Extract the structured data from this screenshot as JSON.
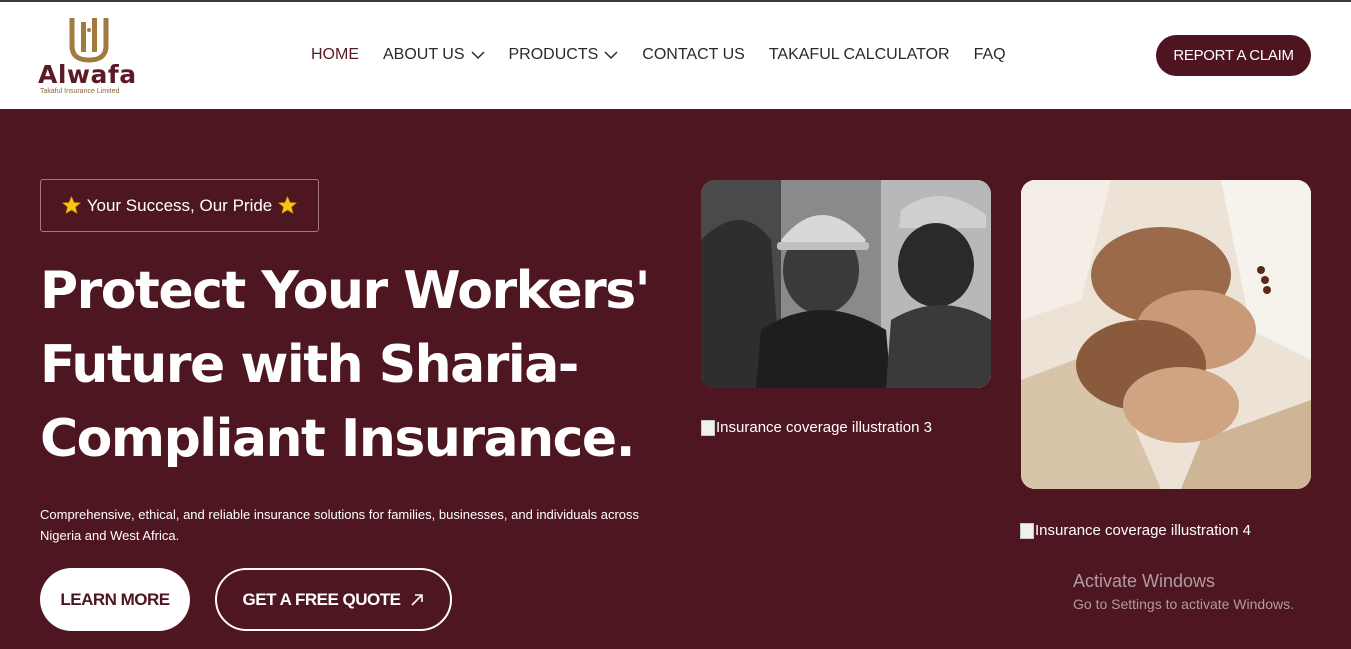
{
  "brand": {
    "name": "Alwafa",
    "tagline": "Takaful Insurance Limited",
    "colors": {
      "primary": "#4e1520",
      "hero_bg": "#4e1620",
      "gold": "#a07a3e"
    }
  },
  "nav": {
    "items": [
      {
        "label": "HOME",
        "active": true,
        "dropdown": false
      },
      {
        "label": "ABOUT US",
        "active": false,
        "dropdown": true
      },
      {
        "label": "PRODUCTS",
        "active": false,
        "dropdown": true
      },
      {
        "label": "CONTACT US",
        "active": false,
        "dropdown": false
      },
      {
        "label": "TAKAFUL CALCULATOR",
        "active": false,
        "dropdown": false
      },
      {
        "label": "FAQ",
        "active": false,
        "dropdown": false
      }
    ],
    "cta_label": "REPORT A CLAIM"
  },
  "hero": {
    "badge": "Your Success, Our Pride",
    "badge_icon": "star-icon",
    "headline_lines": [
      "Protect Your Workers'",
      "Future with Sharia-",
      "Compliant Insurance."
    ],
    "subtext": "Comprehensive, ethical, and reliable insurance solutions for families, businesses, and individuals across Nigeria and West Africa.",
    "learn_more": "LEARN MORE",
    "get_quote": "GET A FREE QUOTE",
    "quote_icon": "arrow-up-right-icon"
  },
  "images": {
    "illustration3_alt": "Insurance coverage illustration 3",
    "illustration4_alt": "Insurance coverage illustration 4"
  },
  "watermark": {
    "title": "Activate Windows",
    "subtitle": "Go to Settings to activate Windows."
  }
}
